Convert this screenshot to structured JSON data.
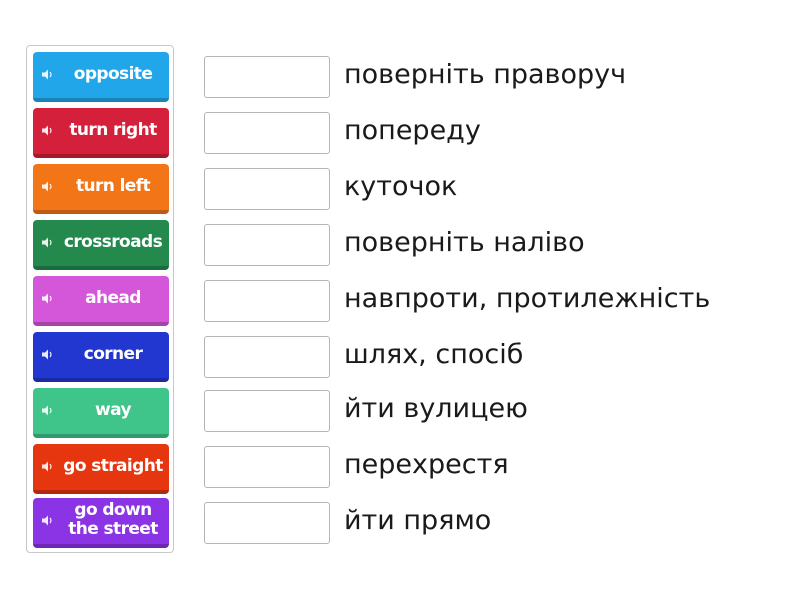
{
  "tiles": [
    {
      "label": "opposite",
      "color": "#21a7e9"
    },
    {
      "label": "turn right",
      "color": "#d4203a"
    },
    {
      "label": "turn left",
      "color": "#f27518"
    },
    {
      "label": "crossroads",
      "color": "#23894d"
    },
    {
      "label": "ahead",
      "color": "#d456d9"
    },
    {
      "label": "corner",
      "color": "#2237cf"
    },
    {
      "label": "way",
      "color": "#3fc48a"
    },
    {
      "label": "go straight",
      "color": "#e5360f"
    },
    {
      "label": "go down\nthe street",
      "color": "#8b34e6"
    }
  ],
  "answers": [
    {
      "text": "поверніть праворуч"
    },
    {
      "text": "попереду"
    },
    {
      "text": "куточок"
    },
    {
      "text": "поверніть наліво"
    },
    {
      "text": "навпроти, протилежність"
    },
    {
      "text": "шлях, спосіб"
    },
    {
      "text": "йти вулицею"
    },
    {
      "text": "перехрестя"
    },
    {
      "text": "йти прямо"
    }
  ],
  "icons": {
    "tile_audio": "speaker-icon"
  }
}
